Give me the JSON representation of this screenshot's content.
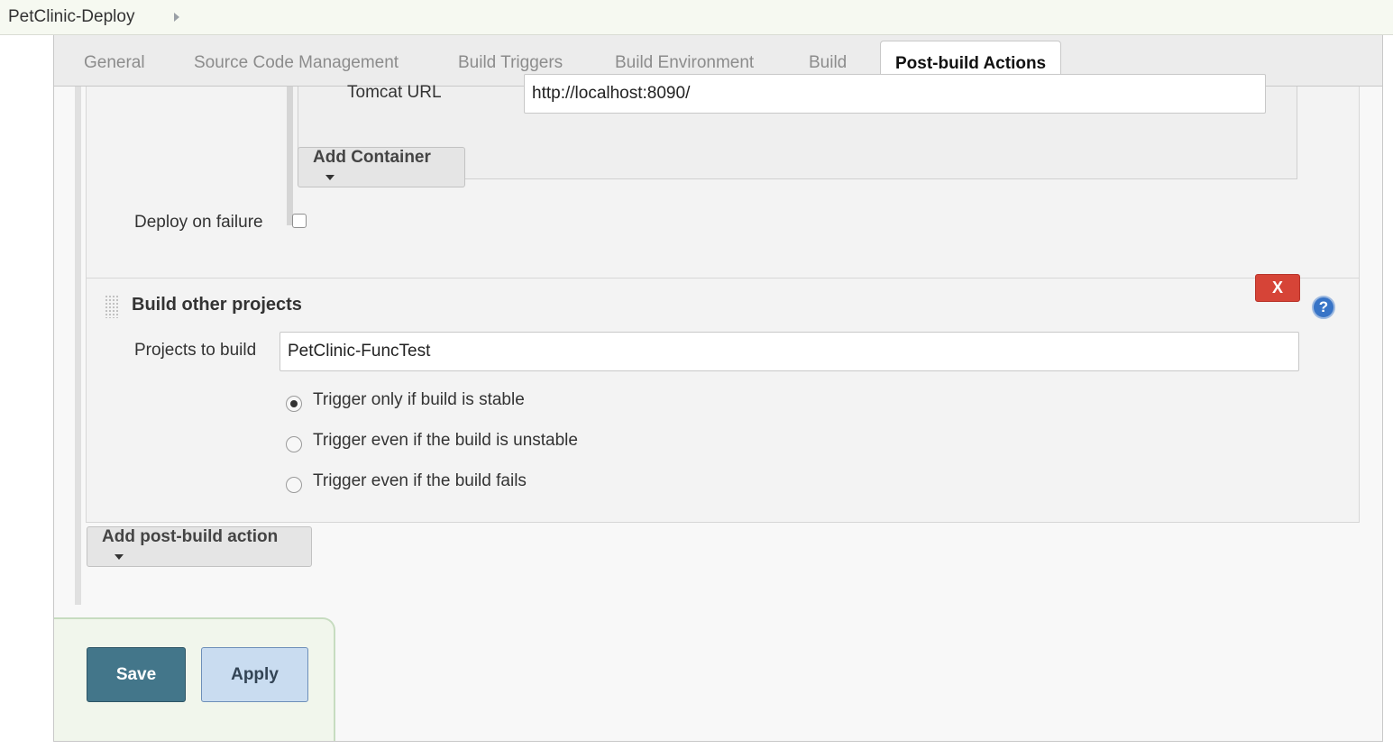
{
  "breadcrumb": {
    "project": "PetClinic-Deploy"
  },
  "tabs": [
    {
      "label": "General"
    },
    {
      "label": "Source Code Management"
    },
    {
      "label": "Build Triggers"
    },
    {
      "label": "Build Environment"
    },
    {
      "label": "Build"
    },
    {
      "label": "Post-build Actions"
    }
  ],
  "active_tab": "Post-build Actions",
  "deploy_section": {
    "tomcat_url_label": "Tomcat URL",
    "tomcat_url_value": "http://localhost:8090/",
    "add_container_label": "Add Container",
    "deploy_on_failure_label": "Deploy on failure",
    "deploy_on_failure_checked": false
  },
  "build_other_projects": {
    "title": "Build other projects",
    "delete_label": "X",
    "help_glyph": "?",
    "projects_label": "Projects to build",
    "projects_value": "PetClinic-FuncTest",
    "options": [
      {
        "label": "Trigger only if build is stable",
        "checked": true
      },
      {
        "label": "Trigger even if the build is unstable",
        "checked": false
      },
      {
        "label": "Trigger even if the build fails",
        "checked": false
      }
    ]
  },
  "add_post_build_label": "Add post-build action",
  "footer": {
    "save_label": "Save",
    "apply_label": "Apply"
  },
  "colors": {
    "save_bg": "#43768a",
    "apply_bg": "#c9dcf0",
    "delete_bg": "#d64437",
    "help_bg": "#3874c7"
  },
  "icons": {
    "breadcrumb_arrow": "chevron-right-icon",
    "dropdown_caret": "caret-down-icon",
    "help": "help-icon",
    "drag_handle": "drag-handle-icon"
  }
}
